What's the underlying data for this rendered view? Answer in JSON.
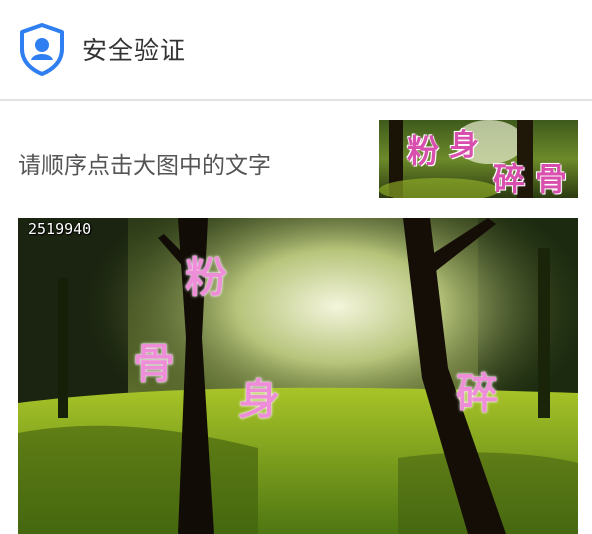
{
  "header": {
    "title": "安全验证",
    "icon": "shield-user-icon",
    "accent_color": "#2f7ff2"
  },
  "instruction": "请顺序点击大图中的文字",
  "hint_image": {
    "characters": [
      "粉",
      "身",
      "碎",
      "骨"
    ]
  },
  "captcha": {
    "id_text": "2519940",
    "characters": [
      "粉",
      "骨",
      "身",
      "碎"
    ]
  }
}
